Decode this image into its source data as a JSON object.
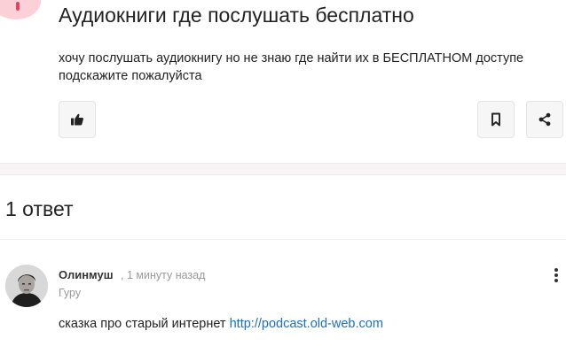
{
  "question": {
    "title": "Аудиокниги где послушать бесплатно",
    "text": "хочу послушать аудиокнигу но не знаю где найти их в БЕСПЛАТНОМ доступе подскажите пожалуйста",
    "icons": {
      "like": "thumbs-up-icon",
      "bookmark": "bookmark-icon",
      "share": "share-icon"
    }
  },
  "answers": {
    "count_label": "1 ответ",
    "items": [
      {
        "user_name": "Олинмуш",
        "time": ", 1 минуту назад",
        "rank": "Гуру",
        "text": "сказка про старый интернет ",
        "link_text": "http://podcast.old-web.com"
      }
    ]
  },
  "colors": {
    "accent_pink": "#fbd0d6",
    "link": "#1a6fc8",
    "separator": "#f8f4f5"
  }
}
